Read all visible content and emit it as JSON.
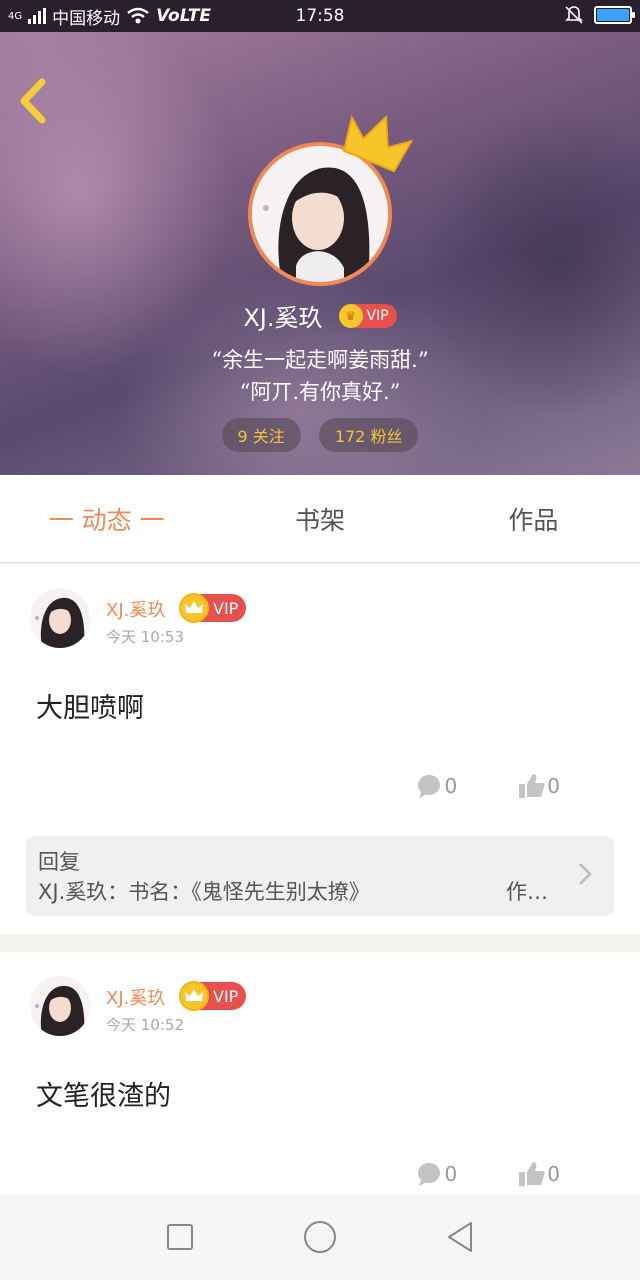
{
  "status_bar": {
    "network": "4G",
    "carrier": "中国移动",
    "volte": "VoLTE",
    "time": "17:58",
    "battery_level": 1.0,
    "icons": [
      "signal-icon",
      "wifi-icon",
      "bell-off-icon",
      "battery-icon"
    ]
  },
  "profile": {
    "name": "XJ.奚玖",
    "vip_label": "VIP",
    "bio_line1": "“余生一起走啊姜雨甜.”",
    "bio_line2": "“阿丌.有你真好.”",
    "following": "9 关注",
    "followers": "172 粉丝"
  },
  "tabs": [
    {
      "label": "一 动态 一",
      "active": true
    },
    {
      "label": "书架",
      "active": false
    },
    {
      "label": "作品",
      "active": false
    }
  ],
  "posts": [
    {
      "author": "XJ.奚玖",
      "vip_label": "VIP",
      "time": "今天  10:53",
      "text": "大胆喷啊",
      "comments": "0",
      "likes": "0",
      "reply_title": "回复",
      "reply_body": "XJ.奚玖：书名：《鬼怪先生别太撩》",
      "reply_more": "作…"
    },
    {
      "author": "XJ.奚玖",
      "vip_label": "VIP",
      "time": "今天  10:52",
      "text": "文笔很渣的",
      "comments": "0",
      "likes": "0"
    }
  ],
  "colors": {
    "accent": "#f08a55",
    "vip_red": "#e8504e",
    "gold": "#f8c62c"
  }
}
